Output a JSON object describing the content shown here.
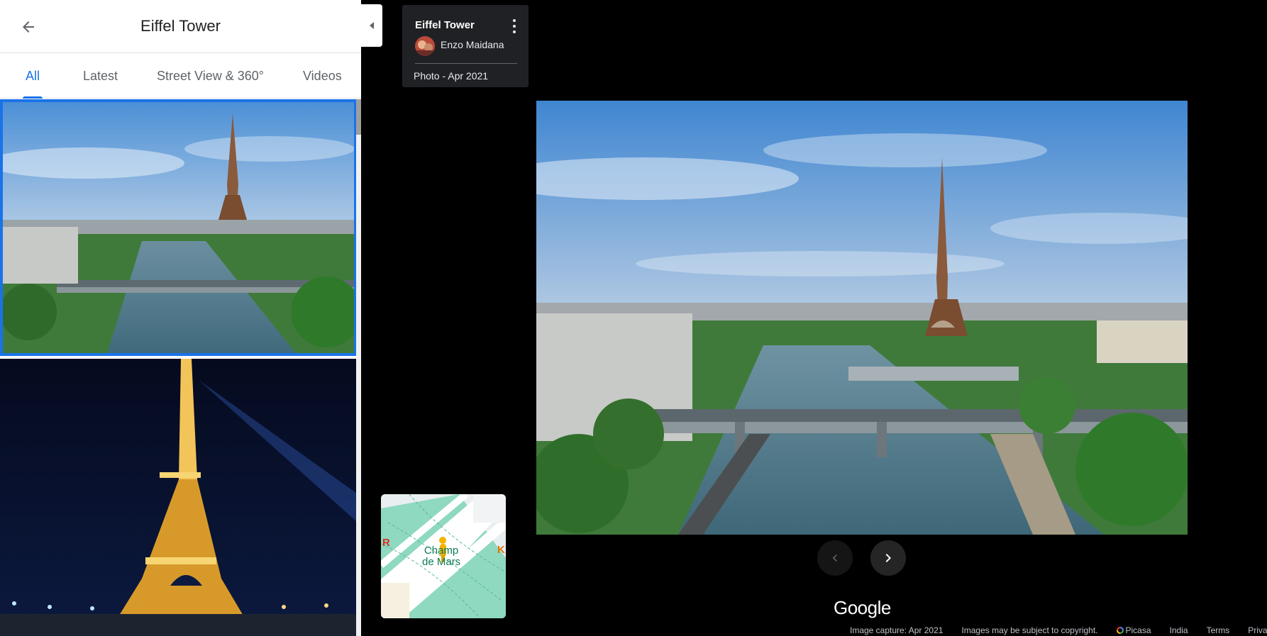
{
  "header": {
    "title": "Eiffel Tower"
  },
  "tabs": [
    {
      "label": "All"
    },
    {
      "label": "Latest"
    },
    {
      "label": "Street View & 360°"
    },
    {
      "label": "Videos"
    }
  ],
  "info_card": {
    "title": "Eiffel Tower",
    "author": "Enzo Maidana",
    "date": "Photo - Apr 2021"
  },
  "minimap": {
    "label_line1": "Champ",
    "label_line2": "de Mars",
    "edge_left": "R",
    "edge_right": "K"
  },
  "logo": "Google",
  "footer": {
    "capture": "Image capture: Apr 2021",
    "copyright": "Images may be subject to copyright.",
    "picasa": "Picasa",
    "country": "India",
    "terms": "Terms",
    "privacy": "Privacy"
  },
  "colors": {
    "accent": "#1a73e8",
    "card_bg": "#202124",
    "map_park": "#8ed9c0"
  }
}
